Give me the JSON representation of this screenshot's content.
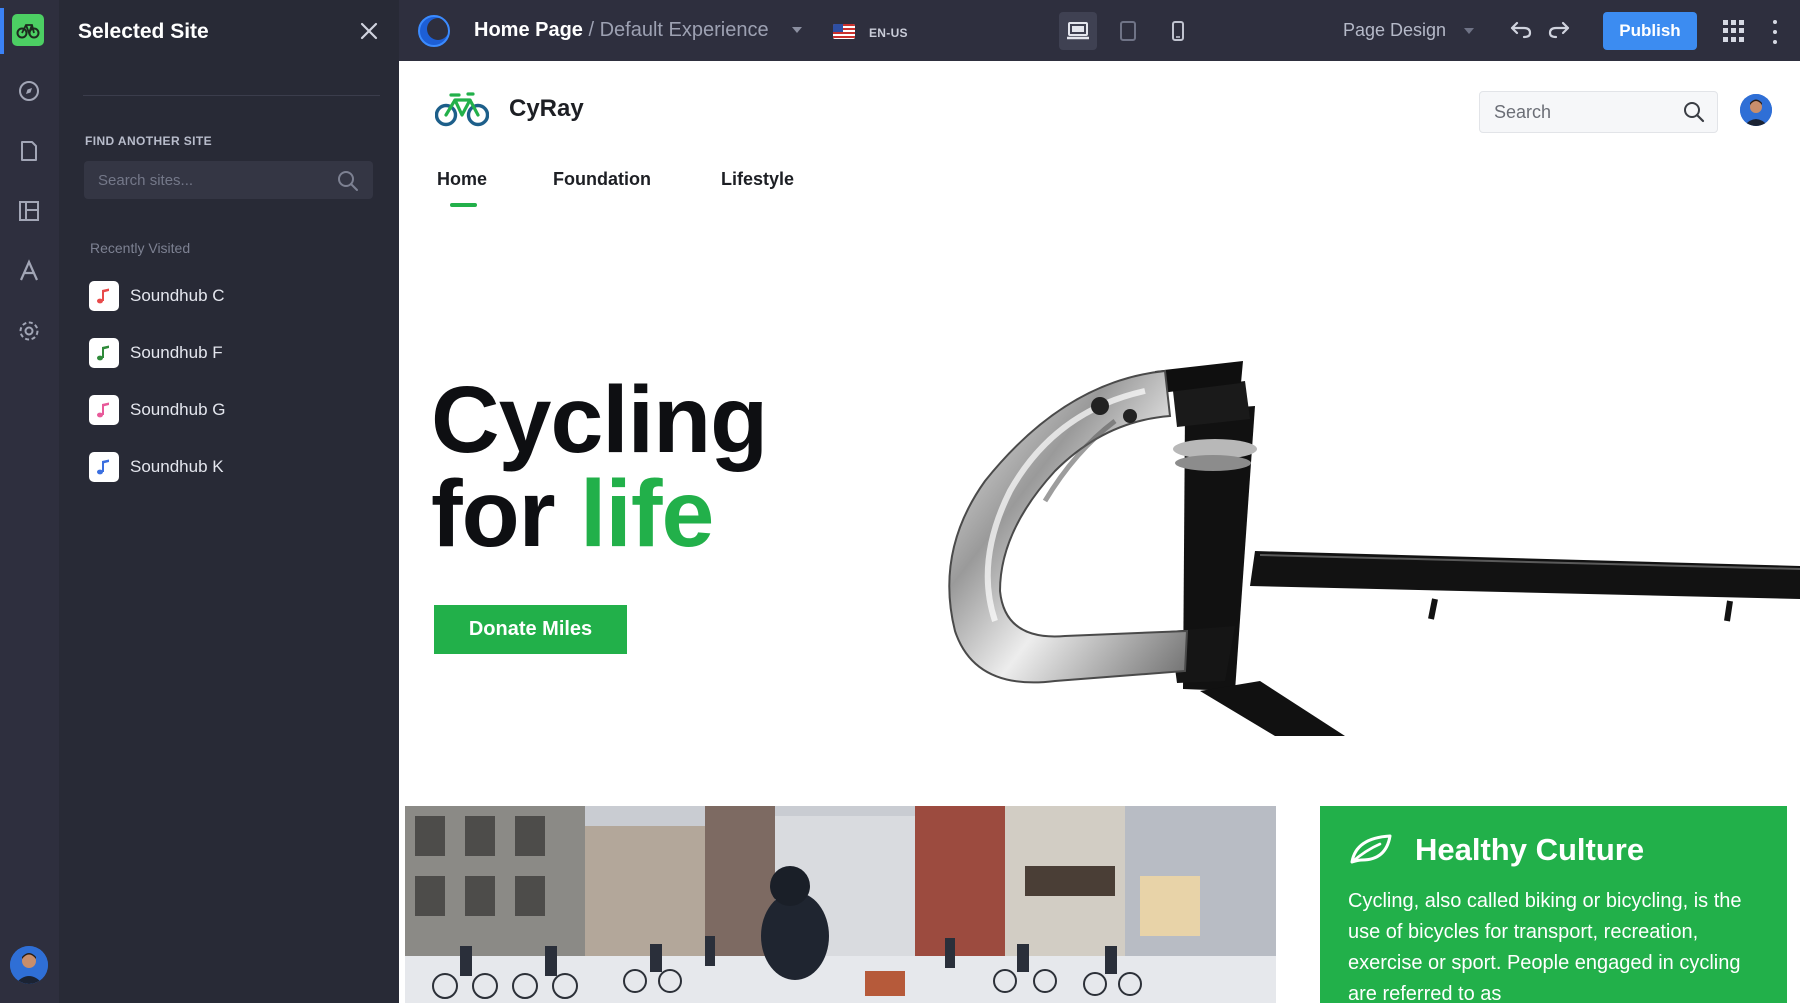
{
  "panel": {
    "title": "Selected Site",
    "find_label": "FIND ANOTHER SITE",
    "search_placeholder": "Search sites...",
    "recent_label": "Recently Visited",
    "sites": [
      {
        "label": "Soundhub C",
        "color": "#e84a4a"
      },
      {
        "label": "Soundhub F",
        "color": "#2f8a3a"
      },
      {
        "label": "Soundhub G",
        "color": "#e85a9a"
      },
      {
        "label": "Soundhub K",
        "color": "#3b6fe0"
      }
    ]
  },
  "rail": {
    "icons": [
      "compass-icon",
      "page-icon",
      "layout-icon",
      "typography-icon",
      "settings-icon"
    ]
  },
  "toolbar": {
    "page": "Home Page",
    "separator": " / ",
    "experience": "Default Experience",
    "language": "EN-US",
    "mode": "Page Design",
    "publish": "Publish"
  },
  "site": {
    "brand": "CyRay",
    "search_placeholder": "Search",
    "nav": [
      "Home",
      "Foundation",
      "Lifestyle"
    ],
    "active_nav": "Home",
    "hero_line1": "Cycling",
    "hero_line2_a": "for ",
    "hero_line2_b": "life",
    "cta": "Donate Miles",
    "card_title": "Healthy Culture",
    "card_body": "Cycling, also called biking or bicycling, is the use of bicycles for transport, recreation, exercise or sport. People engaged in cycling are referred to as"
  },
  "colors": {
    "accent_green": "#22b04a",
    "publish_blue": "#3c8cf1",
    "sidebar_bg": "#282a36",
    "toolbar_bg": "#2e2f3e"
  }
}
